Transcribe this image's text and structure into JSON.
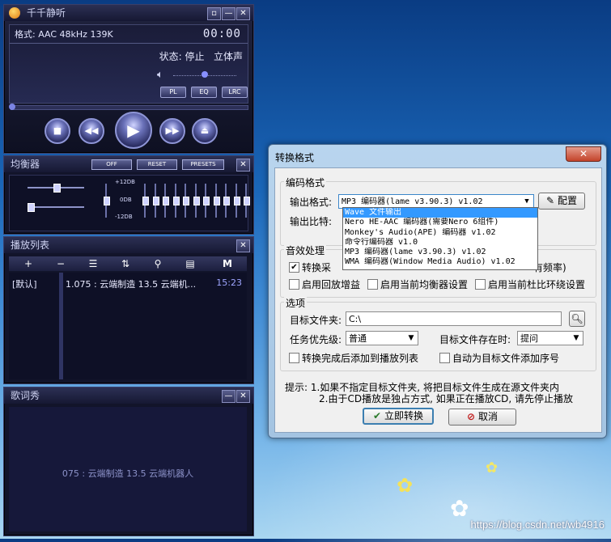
{
  "player": {
    "title": "千千静听",
    "format": "格式: AAC 48kHz 139K",
    "time": "00:00",
    "status": "状态: 停止",
    "channel": "立体声",
    "mini_buttons": [
      "PL",
      "EQ",
      "LRC"
    ],
    "volume_fraction": 0.5,
    "seek_fraction": 0.0
  },
  "equalizer": {
    "title": "均衡器",
    "buttons": [
      "OFF",
      "RESET",
      "PRESETS"
    ],
    "db_top": "+12DB",
    "db_mid": "0DB",
    "db_bot": "-12DB",
    "band_levels": [
      0.5,
      0.5,
      0.5,
      0.5,
      0.5,
      0.5,
      0.5,
      0.5,
      0.5,
      0.5,
      0.5
    ]
  },
  "playlist": {
    "title": "播放列表",
    "group": "[默认]",
    "row_text": "1.075 : 云端制造 13.5 云端机...",
    "row_duration": "15:23"
  },
  "lyrics": {
    "title": "歌词秀",
    "text": "075 : 云端制造 13.5 云端机器人"
  },
  "dialog": {
    "title": "转换格式",
    "encoder_group": "编码格式",
    "output_format_label": "输出格式:",
    "output_format_value": "MP3 编码器(lame v3.90.3) v1.02",
    "config_button": "配置",
    "bitrate_label": "输出比特:",
    "dropdown_options": [
      "Wave 文件输出",
      "Nero HE-AAC 编码器(需要Nero 6组件)",
      "Monkey's Audio(APE) 编码器 v1.02",
      "命令行编码器 v1.0",
      "MP3 编码器(lame v3.90.3) v1.02",
      "WMA 编码器(Window Media Audio) v1.02"
    ],
    "effects_group": "音效处理",
    "convert_sample_label": "转换采",
    "all_freq_label": "有频率)",
    "replay_gain_label": "启用回放增益",
    "eq_label": "启用当前均衡器设置",
    "dolby_label": "启用当前杜比环绕设置",
    "options_group": "选项",
    "target_folder_label": "目标文件夹:",
    "target_folder_value": "C:\\",
    "priority_label": "任务优先级:",
    "priority_value": "普通",
    "exists_label": "目标文件存在时:",
    "exists_value": "提问",
    "add_playlist_label": "转换完成后添加到播放列表",
    "auto_seq_label": "自动为目标文件添加序号",
    "hint_line1": "提示: 1.如果不指定目标文件夹, 将把目标文件生成在源文件夹内",
    "hint_line2": "2.由于CD播放是独占方式, 如果正在播放CD, 请先停止播放",
    "convert_button": "立即转换",
    "cancel_button": "取消"
  },
  "desktop": {
    "watermark": "https://blog.csdn.net/wb4916"
  },
  "colors": {
    "player_bg": "#12142a",
    "dialog_frame": "#a4c4e2",
    "highlight": "#3399ff"
  }
}
